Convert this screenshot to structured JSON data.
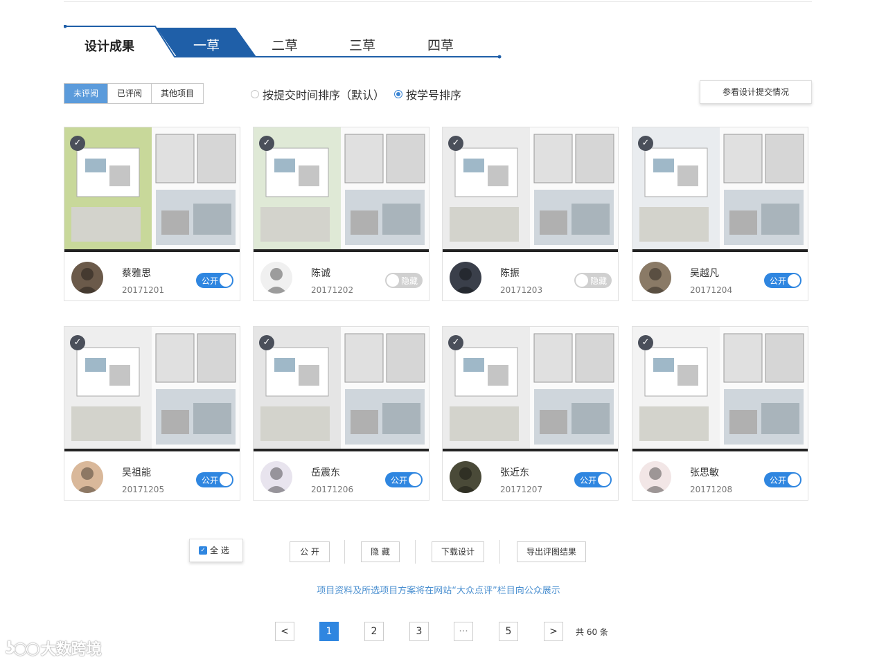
{
  "tabs": {
    "main": "设计成果",
    "items": [
      {
        "label": "一草",
        "active": true
      },
      {
        "label": "二草",
        "active": false
      },
      {
        "label": "三草",
        "active": false
      },
      {
        "label": "四草",
        "active": false
      }
    ]
  },
  "filters": [
    {
      "label": "未评阅",
      "active": true
    },
    {
      "label": "已评阅",
      "active": false
    },
    {
      "label": "其他项目",
      "active": false
    }
  ],
  "sort": {
    "by_time": "按提交时间排序（默认）",
    "by_id": "按学号排序",
    "selected": "by_id"
  },
  "view_submission_label": "参看设计提交情况",
  "cards": [
    {
      "name": "蔡雅思",
      "id": "20171201",
      "public": true,
      "toggle_label": "公开"
    },
    {
      "name": "陈诚",
      "id": "20171202",
      "public": false,
      "toggle_label": "隐藏"
    },
    {
      "name": "陈振",
      "id": "20171203",
      "public": false,
      "toggle_label": "隐藏"
    },
    {
      "name": "吴越凡",
      "id": "20171204",
      "public": true,
      "toggle_label": "公开"
    },
    {
      "name": "吴祖能",
      "id": "20171205",
      "public": true,
      "toggle_label": "公开"
    },
    {
      "name": "岳震东",
      "id": "20171206",
      "public": true,
      "toggle_label": "公开"
    },
    {
      "name": "张近东",
      "id": "20171207",
      "public": true,
      "toggle_label": "公开"
    },
    {
      "name": "张思敏",
      "id": "20171208",
      "public": true,
      "toggle_label": "公开"
    }
  ],
  "actions": {
    "select_all": "全 选",
    "public": "公 开",
    "hide": "隐 藏",
    "download": "下载设计",
    "export": "导出评图结果"
  },
  "notice": "项目资料及所选项目方案将在网站“大众点评”栏目向公众展示",
  "pagination": {
    "prev": "<",
    "pages": [
      "1",
      "2",
      "3",
      "···",
      "5"
    ],
    "current": "1",
    "next": ">",
    "total": "共 60 条"
  },
  "watermark": "大数跨境",
  "colors": {
    "accent": "#2f86e0",
    "tab_active": "#1f5fa8",
    "filter_active": "#5b9bdb"
  }
}
